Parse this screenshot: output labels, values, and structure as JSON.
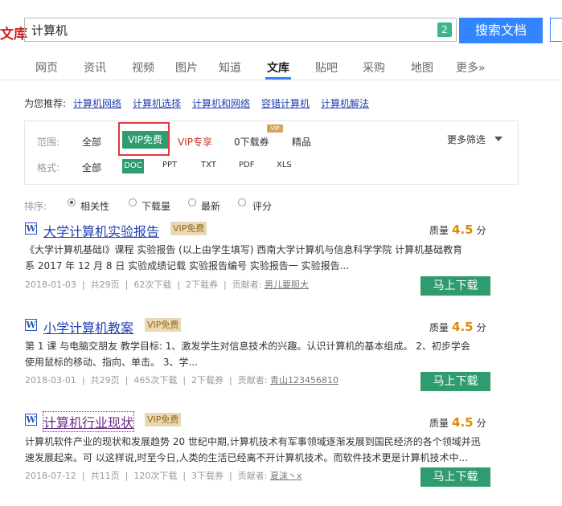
{
  "header": {
    "logo": "文库",
    "search_value": "计算机",
    "search_badge": "2",
    "search_button": "搜索文档"
  },
  "nav": {
    "tabs": [
      "网页",
      "资讯",
      "视频",
      "图片",
      "知道",
      "文库",
      "贴吧",
      "采购",
      "地图",
      "更多»"
    ],
    "active": "文库"
  },
  "recommend": {
    "label": "为您推荐:",
    "links": [
      "计算机网络",
      "计算机选择",
      "计算机和网络",
      "容错计算机",
      "计算机解法"
    ]
  },
  "filters": {
    "scope_label": "范围:",
    "scope_options": [
      "全部",
      "VIP免费",
      "VIP专享",
      "0下载券",
      "精品"
    ],
    "vip_tag": "VIP",
    "format_label": "格式:",
    "format_options": [
      "全部",
      "DOC",
      "PPT",
      "TXT",
      "PDF",
      "XLS"
    ],
    "more": "更多筛选"
  },
  "sort": {
    "label": "排序:",
    "options": [
      "相关性",
      "下载量",
      "最新",
      "评分"
    ],
    "selected": "相关性"
  },
  "results": [
    {
      "title": "大学计算机实验报告",
      "badge": "VIP免费",
      "quality_label": "质量",
      "quality": "4.5",
      "quality_unit": "分",
      "snippet_line1": "《大学计算机基础Ⅰ》课程 实验报告 (以上由学生填写) 西南大学计算机与信息科学学院 计算机基础教育",
      "snippet_line2": "系 2017 年 12 月 8 日 实验成绩记载 实验报告编号 实验报告一 实验报告...",
      "date": "2018-01-03",
      "pages": "共29页",
      "downloads": "62次下载",
      "coupons": "2下载券",
      "contributor_label": "贡献者:",
      "contributor": "男儿要胆大",
      "download_button": "马上下载"
    },
    {
      "title": "小学计算机教案",
      "badge": "VIP免费",
      "quality_label": "质量",
      "quality": "4.5",
      "quality_unit": "分",
      "snippet_line1": "第 1 课 与电脑交朋友 教学目标: 1、激发学生对信息技术的兴趣。认识计算机的基本组成。 2、初步学会",
      "snippet_line2": "使用鼠标的移动、指向、单击。 3、学...",
      "date": "2018-03-01",
      "pages": "共29页",
      "downloads": "465次下载",
      "coupons": "2下载券",
      "contributor_label": "贡献者:",
      "contributor": "青山123456810",
      "download_button": "马上下载"
    },
    {
      "title": "计算机行业现状",
      "badge": "VIP免费",
      "quality_label": "质量",
      "quality": "4.5",
      "quality_unit": "分",
      "snippet_line1": "计算机软件产业的现状和发展趋势 20 世纪中期,计算机技术有军事领域逐渐发展到国民经济的各个领域并迅",
      "snippet_line2": "速发展起来。可 以这样说,时至今日,人类的生活已经离不开计算机技术。而软件技术更是计算机技术中...",
      "date": "2018-07-12",
      "pages": "共11页",
      "downloads": "120次下载",
      "coupons": "3下载券",
      "contributor_label": "贡献者:",
      "contributor": "夏沫丶x",
      "download_button": "马上下载"
    }
  ]
}
